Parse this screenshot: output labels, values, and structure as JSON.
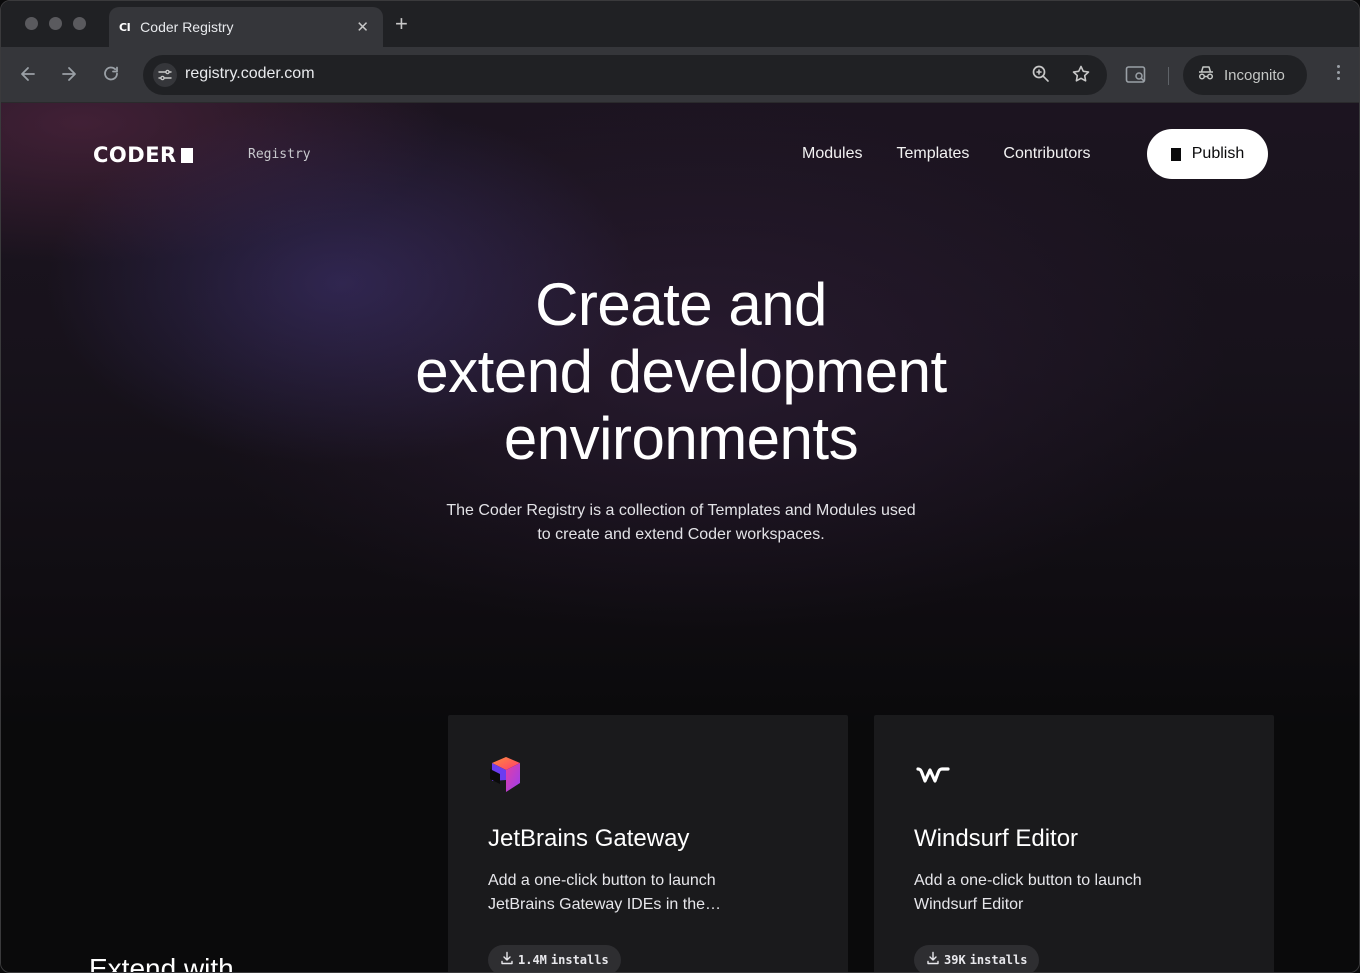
{
  "browser": {
    "tab_title": "Coder Registry",
    "tab_favicon": "CI",
    "url": "registry.coder.com",
    "profile_label": "Incognito",
    "icons": [
      "back-icon",
      "forward-icon",
      "reload-icon",
      "site-settings-icon",
      "zoom-icon",
      "bookmark-star-icon",
      "side-panel-icon",
      "incognito-icon",
      "more-menu-icon",
      "close-icon",
      "new-tab-icon"
    ]
  },
  "header": {
    "logo_text": "CODER",
    "logo_sub": "Registry",
    "nav": [
      "Modules",
      "Templates",
      "Contributors"
    ],
    "publish_label": "Publish"
  },
  "hero": {
    "title_lines": [
      "Create and",
      "extend development",
      "environments"
    ],
    "subtitle_lines": [
      "The Coder Registry is a collection of Templates and Modules used",
      "to create and extend Coder workspaces."
    ]
  },
  "cards": [
    {
      "title": "JetBrains Gateway",
      "description": "Add a one-click button to launch JetBrains Gateway IDEs in the…",
      "installs_value": "1.4M",
      "installs_unit": "installs",
      "icon": "jetbrains-gateway-logo"
    },
    {
      "title": "Windsurf Editor",
      "description": "Add a one-click button to launch Windsurf Editor",
      "installs_value": "39K",
      "installs_unit": "installs",
      "icon": "windsurf-logo"
    }
  ],
  "section": {
    "extend_heading": "Extend with"
  }
}
